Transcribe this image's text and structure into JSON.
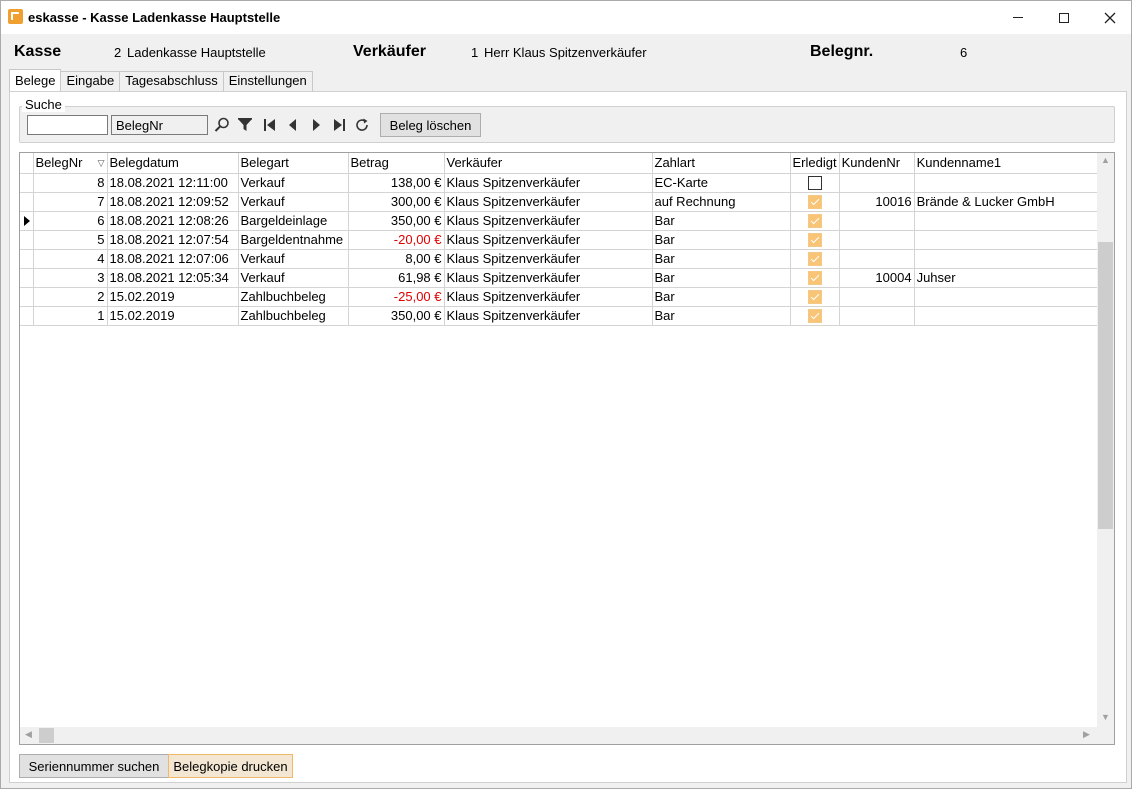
{
  "window": {
    "title": "eskasse - Kasse Ladenkasse Hauptstelle"
  },
  "header": {
    "kasse_label": "Kasse",
    "kasse_nr": "2",
    "kasse_name": "Ladenkasse Hauptstelle",
    "verkaeufer_label": "Verkäufer",
    "verkaeufer_nr": "1",
    "verkaeufer_name": "Herr Klaus Spitzenverkäufer",
    "belegnr_label": "Belegnr.",
    "belegnr_value": "6"
  },
  "tabs": [
    {
      "label": "Belege",
      "active": true
    },
    {
      "label": "Eingabe",
      "active": false
    },
    {
      "label": "Tagesabschluss",
      "active": false
    },
    {
      "label": "Einstellungen",
      "active": false
    }
  ],
  "search": {
    "legend": "Suche",
    "query": "",
    "field": "BelegNr",
    "delete_button": "Beleg löschen"
  },
  "toolbar_icons": [
    "search-icon",
    "filter-icon",
    "first-record-icon",
    "prev-record-icon",
    "next-record-icon",
    "last-record-icon",
    "refresh-icon"
  ],
  "table": {
    "columns": [
      "BelegNr",
      "Belegdatum",
      "Belegart",
      "Betrag",
      "Verkäufer",
      "Zahlart",
      "Erledigt",
      "KundenNr",
      "Kundenname1"
    ],
    "current_row_index": 2,
    "rows": [
      {
        "belegnr": "8",
        "datum": "18.08.2021 12:11:00",
        "art": "Verkauf",
        "betrag": "138,00 €",
        "negative": false,
        "verkaeufer": "Klaus Spitzenverkäufer",
        "zahlart": "EC-Karte",
        "erledigt": false,
        "kundennr": "",
        "kundenname": ""
      },
      {
        "belegnr": "7",
        "datum": "18.08.2021 12:09:52",
        "art": "Verkauf",
        "betrag": "300,00 €",
        "negative": false,
        "verkaeufer": "Klaus Spitzenverkäufer",
        "zahlart": "auf Rechnung",
        "erledigt": true,
        "kundennr": "10016",
        "kundenname": "Brände & Lucker GmbH"
      },
      {
        "belegnr": "6",
        "datum": "18.08.2021 12:08:26",
        "art": "Bargeldeinlage",
        "betrag": "350,00 €",
        "negative": false,
        "verkaeufer": "Klaus Spitzenverkäufer",
        "zahlart": "Bar",
        "erledigt": true,
        "kundennr": "",
        "kundenname": ""
      },
      {
        "belegnr": "5",
        "datum": "18.08.2021 12:07:54",
        "art": "Bargeldentnahme",
        "betrag": "-20,00 €",
        "negative": true,
        "verkaeufer": "Klaus Spitzenverkäufer",
        "zahlart": "Bar",
        "erledigt": true,
        "kundennr": "",
        "kundenname": ""
      },
      {
        "belegnr": "4",
        "datum": "18.08.2021 12:07:06",
        "art": "Verkauf",
        "betrag": "8,00 €",
        "negative": false,
        "verkaeufer": "Klaus Spitzenverkäufer",
        "zahlart": "Bar",
        "erledigt": true,
        "kundennr": "",
        "kundenname": ""
      },
      {
        "belegnr": "3",
        "datum": "18.08.2021 12:05:34",
        "art": "Verkauf",
        "betrag": "61,98 €",
        "negative": false,
        "verkaeufer": "Klaus Spitzenverkäufer",
        "zahlart": "Bar",
        "erledigt": true,
        "kundennr": "10004",
        "kundenname": "Juhser"
      },
      {
        "belegnr": "2",
        "datum": "15.02.2019",
        "art": "Zahlbuchbeleg",
        "betrag": "-25,00 €",
        "negative": true,
        "verkaeufer": "Klaus Spitzenverkäufer",
        "zahlart": "Bar",
        "erledigt": true,
        "kundennr": "",
        "kundenname": ""
      },
      {
        "belegnr": "1",
        "datum": "15.02.2019",
        "art": "Zahlbuchbeleg",
        "betrag": "350,00 €",
        "negative": false,
        "verkaeufer": "Klaus Spitzenverkäufer",
        "zahlart": "Bar",
        "erledigt": true,
        "kundennr": "",
        "kundenname": ""
      }
    ]
  },
  "footer": {
    "serial_button": "Seriennummer suchen",
    "copy_button": "Belegkopie drucken"
  },
  "colors": {
    "negative_amount": "#e00000",
    "checkbox_checked": "#f8c577",
    "accent": "#f0a030"
  }
}
